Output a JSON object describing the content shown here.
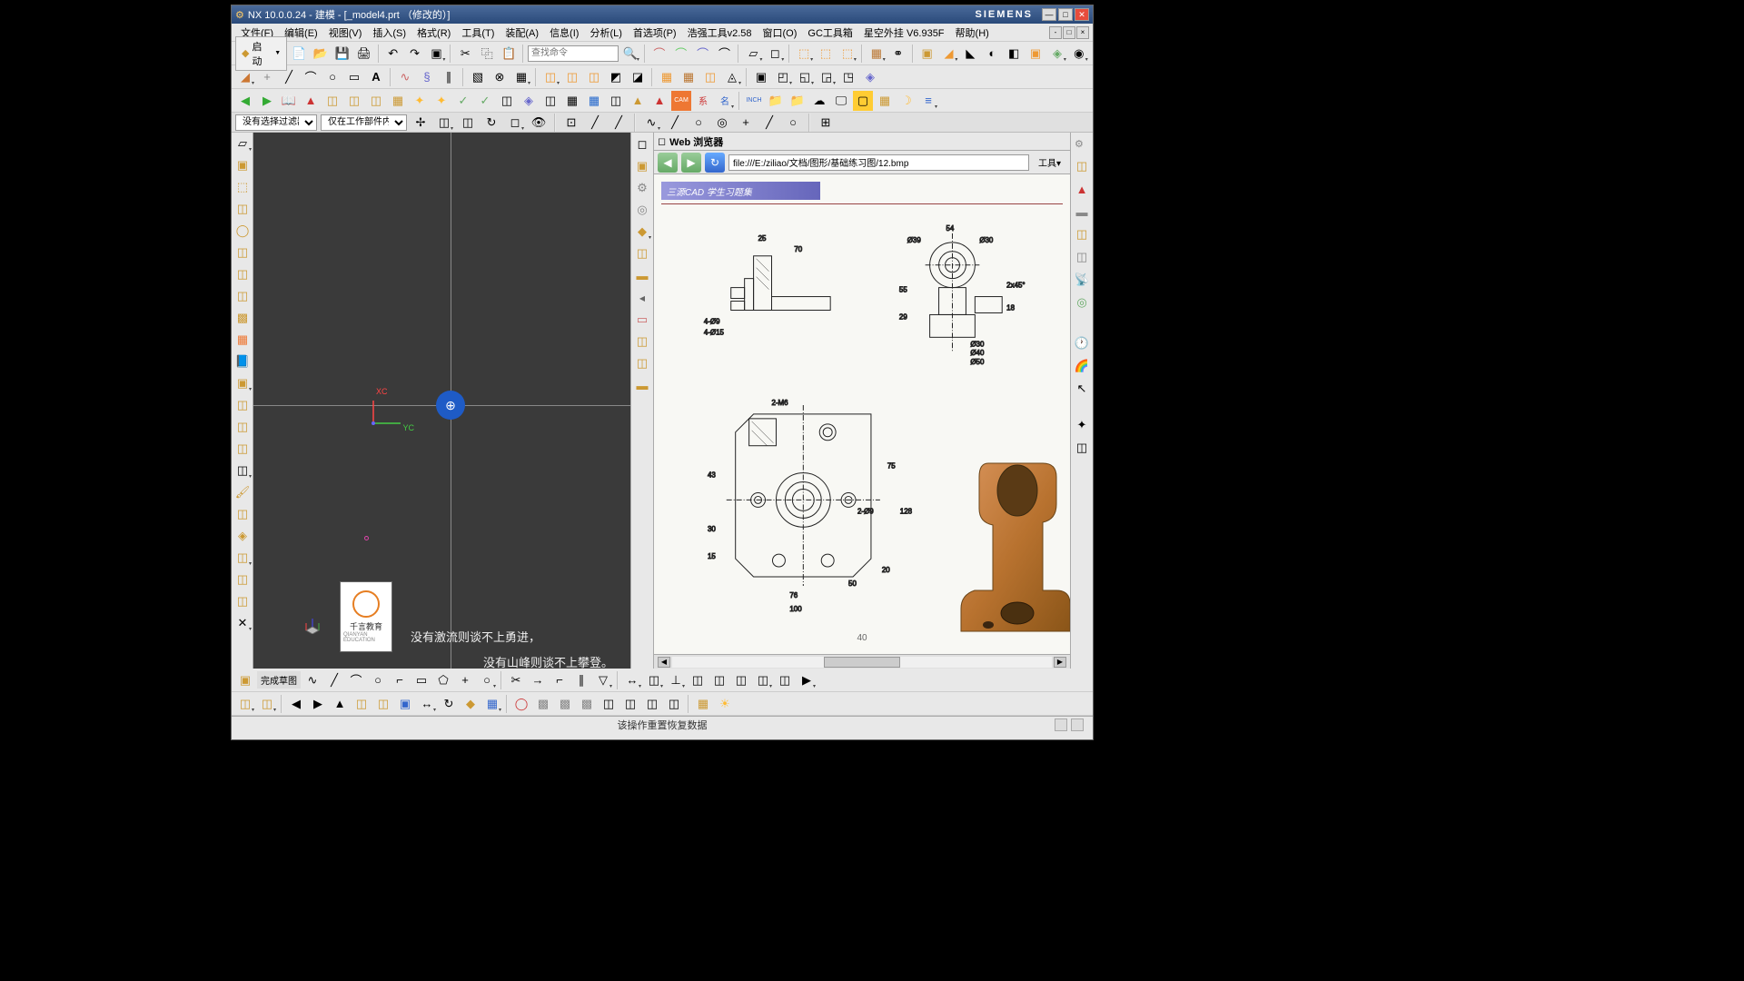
{
  "title_bar": {
    "app_name": "NX 10.0.0.24",
    "mode": "建模",
    "filename": "_model4.prt",
    "modified": "（修改的）",
    "brand": "SIEMENS"
  },
  "menu": {
    "file": "文件(F)",
    "edit": "编辑(E)",
    "view": "视图(V)",
    "insert": "插入(S)",
    "format": "格式(R)",
    "tools": "工具(T)",
    "assembly": "装配(A)",
    "info": "信息(I)",
    "analysis": "分析(L)",
    "preferences": "首选项(P)",
    "hq_tool": "浩强工具v2.58",
    "window": "窗口(O)",
    "gc_toolbox": "GC工具箱",
    "star_plugin": "星空外挂 V6.935F",
    "help": "帮助(H)"
  },
  "toolbar_main": {
    "start": "启动",
    "search_placeholder": "查找命令"
  },
  "filter": {
    "no_filter": "没有选择过滤器",
    "work_part": "仅在工作部件内"
  },
  "viewport": {
    "wcs_x": "XC",
    "wcs_y": "YC",
    "logo_text": "千言教育",
    "logo_sub": "QIANYAN EDUCATION",
    "motto_line1": "没有激流则谈不上勇进，",
    "motto_line2": "没有山峰则谈不上攀登。"
  },
  "browser": {
    "title": "Web 浏览器",
    "url": "file:///E:/ziliao/文档/图形/基础练习图/12.bmp",
    "tools_label": "工具",
    "banner": "三源CAD 学生习题集",
    "page_num": "40"
  },
  "bottom_status": {
    "sketch_label": "完成草图",
    "message": "该操作重置恢复数据"
  },
  "drawing_dims": {
    "d25": "25",
    "d70": "70",
    "d54": "54",
    "d39": "Ø39",
    "d30": "Ø30",
    "d4_9": "4-Ø9",
    "d4_15": "4-Ø15",
    "d55": "55",
    "d29": "29",
    "d2x45": "2x45°",
    "d18": "18",
    "d30b": "Ø30",
    "d40": "Ø40",
    "d50": "Ø50",
    "d2m6": "2-M6",
    "d43": "43",
    "d30c": "30",
    "d15": "15",
    "d76": "76",
    "d100": "100",
    "d75": "75",
    "d128": "128",
    "d20": "20",
    "d50b": "50",
    "d2_9": "2-Ø9"
  }
}
